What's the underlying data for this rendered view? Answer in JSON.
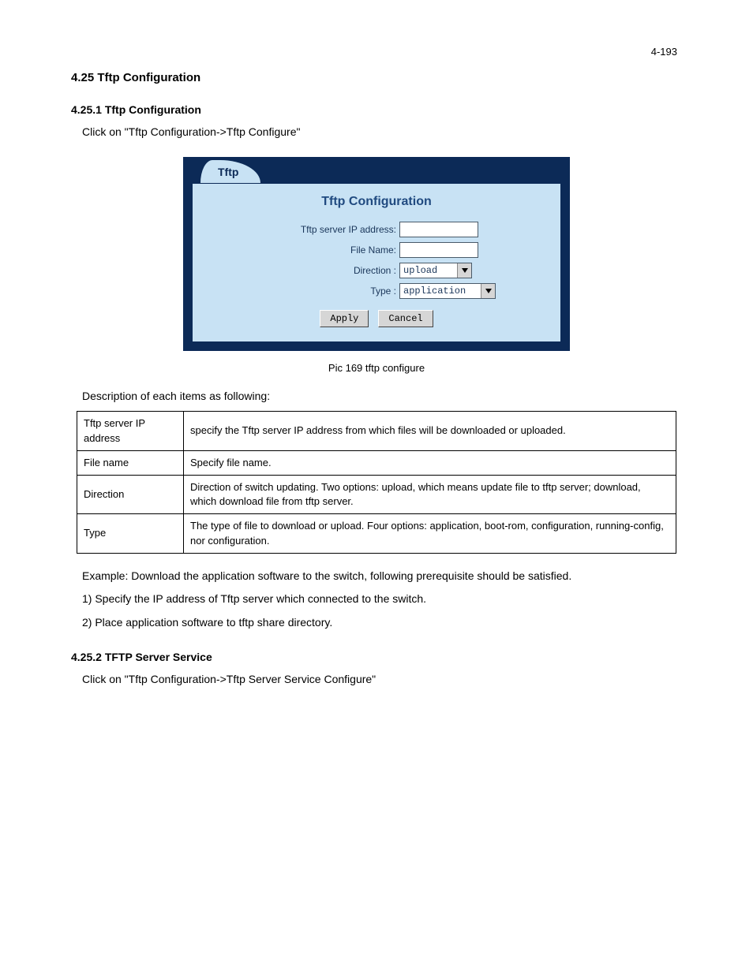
{
  "page_number": "4-193",
  "heading": "4.25 Tftp Configuration",
  "subheading1": "4.25.1 Tftp Configuration",
  "instruction1": "Click on \"Tftp Configuration->Tftp Configure\"",
  "panel": {
    "tab_label": "Tftp",
    "title": "Tftp Configuration",
    "ip_label": "Tftp server IP address:",
    "ip_value": "",
    "file_label": "File Name:",
    "file_value": "",
    "direction_label": "Direction :",
    "direction_value": "upload",
    "type_label": "Type :",
    "type_value": "application",
    "apply_label": "Apply",
    "cancel_label": "Cancel"
  },
  "caption": "Pic 169 tftp configure",
  "table_intro": "Description of each items as following:",
  "table": {
    "rows": [
      {
        "c1": "Tftp server IP address",
        "c2": "specify the Tftp server IP address from which files will be downloaded or uploaded."
      },
      {
        "c1": "File name",
        "c2": "Specify file name."
      },
      {
        "c1": "Direction",
        "c2": "Direction of switch updating. Two options: upload, which means update file to tftp server; download, which download file from tftp server."
      },
      {
        "c1": "Type",
        "c2": "The type of file to download or upload. Four options: application, boot-rom, configuration, running-config, nor configuration."
      }
    ]
  },
  "subheading2": "4.25.2 TFTP Server Service",
  "instruction2": "Click on \"Tftp Configuration->Tftp Server Service Configure\"",
  "foot1": "Example: Download the application software to the switch, following prerequisite should be satisfied.",
  "foot2": "1) Specify the IP address of Tftp server which connected to the switch.",
  "foot3": "2) Place application software to tftp share directory."
}
